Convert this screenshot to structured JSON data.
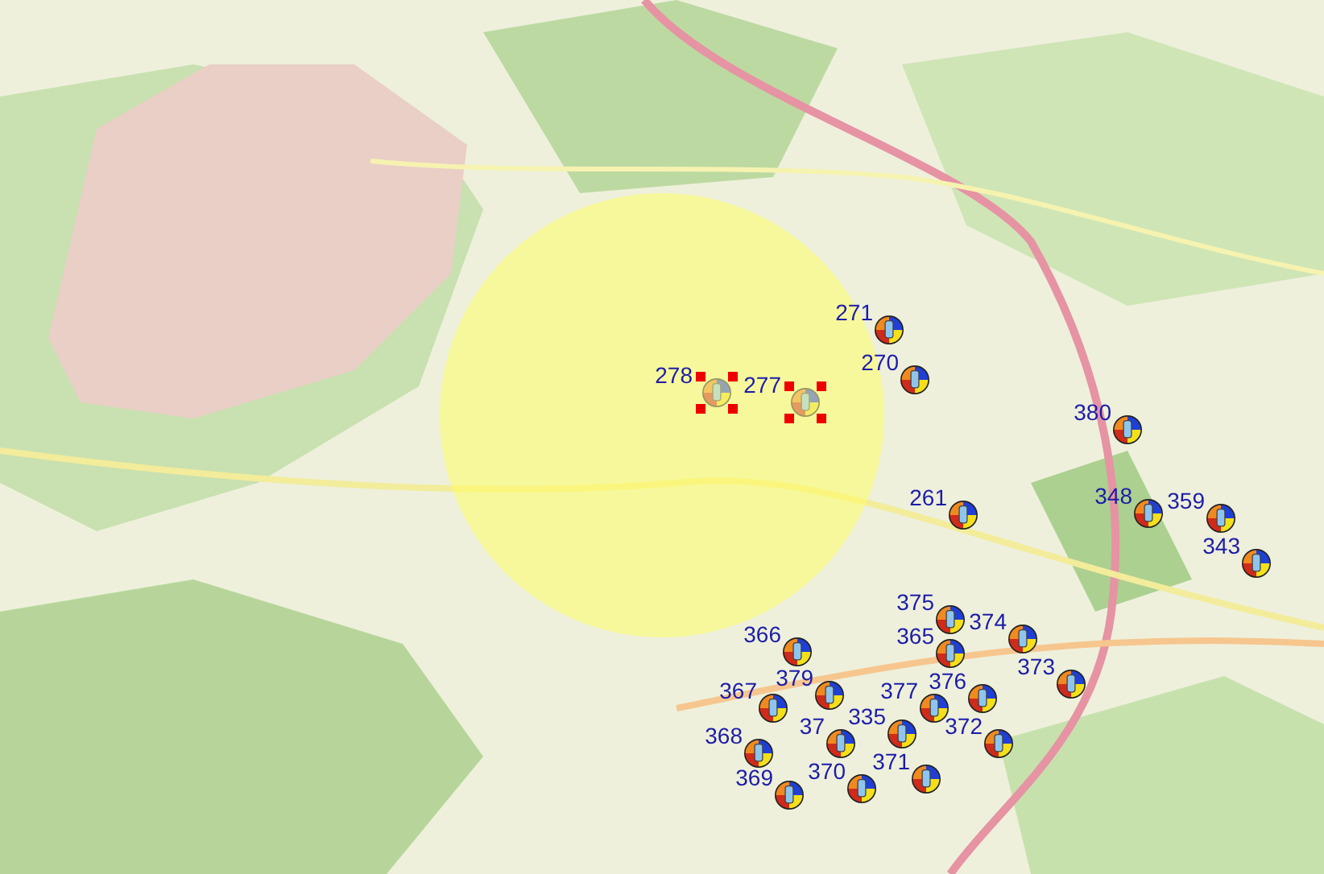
{
  "markers": [
    {
      "label": "271",
      "selected": false
    },
    {
      "label": "270",
      "selected": false
    },
    {
      "label": "278",
      "selected": true
    },
    {
      "label": "277",
      "selected": true
    },
    {
      "label": "380",
      "selected": false
    },
    {
      "label": "261",
      "selected": false
    },
    {
      "label": "348",
      "selected": false
    },
    {
      "label": "359",
      "selected": false
    },
    {
      "label": "343",
      "selected": false
    },
    {
      "label": "375",
      "selected": false
    },
    {
      "label": "365",
      "selected": false
    },
    {
      "label": "374",
      "selected": false
    },
    {
      "label": "373",
      "selected": false
    },
    {
      "label": "376",
      "selected": false
    },
    {
      "label": "366",
      "selected": false
    },
    {
      "label": "379",
      "selected": false
    },
    {
      "label": "367",
      "selected": false
    },
    {
      "label": "37",
      "selected": false
    },
    {
      "label": "335",
      "selected": false
    },
    {
      "label": "377",
      "selected": false
    },
    {
      "label": "372",
      "selected": false
    },
    {
      "label": "368",
      "selected": false
    },
    {
      "label": "370",
      "selected": false
    },
    {
      "label": "371",
      "selected": false
    },
    {
      "label": "369",
      "selected": false
    }
  ]
}
